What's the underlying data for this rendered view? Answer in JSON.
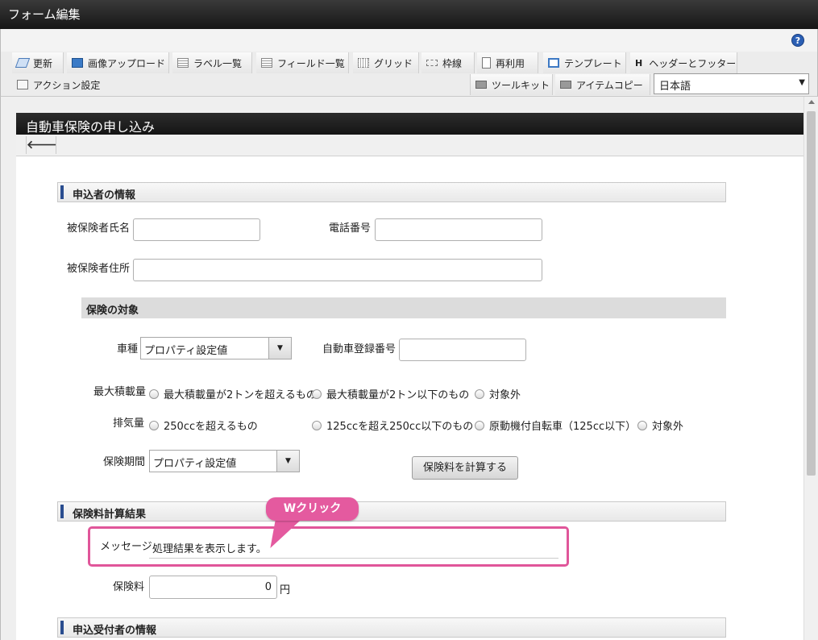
{
  "window": {
    "title": "フォーム編集",
    "help_symbol": "?"
  },
  "toolbar": {
    "row1": [
      {
        "name": "update-button",
        "icon": "update-icon",
        "label": "更新"
      },
      {
        "name": "image-upload-button",
        "icon": "image-icon",
        "label": "画像アップロード"
      },
      {
        "name": "label-list-button",
        "icon": "list-icon",
        "label": "ラベル一覧"
      },
      {
        "name": "field-list-button",
        "icon": "list-icon",
        "label": "フィールド一覧"
      },
      {
        "name": "grid-button",
        "icon": "grid-icon",
        "label": "グリッド"
      },
      {
        "name": "frame-line-button",
        "icon": "frame-icon",
        "label": "枠線"
      },
      {
        "name": "reuse-button",
        "icon": "reuse-icon",
        "label": "再利用"
      },
      {
        "name": "template-button",
        "icon": "template-icon",
        "label": "テンプレート"
      },
      {
        "name": "header-footer-button",
        "icon": "h-icon",
        "label": "ヘッダーとフッター"
      }
    ],
    "row2": [
      {
        "name": "action-settings-button",
        "icon": "action-icon",
        "label": "アクション設定"
      },
      {
        "name": "toolkit-button",
        "icon": "toolkit-icon",
        "label": "ツールキット"
      },
      {
        "name": "item-copy-button",
        "icon": "toolkit-icon",
        "label": "アイテムコピー"
      }
    ],
    "language": {
      "value": "日本語",
      "arrow": "▼"
    },
    "header_icon_letter": "H"
  },
  "form": {
    "title": "自動車保険の申し込み",
    "back_arrow": "🡐",
    "sections": {
      "applicant": "申込者の情報",
      "coverage": "保険の対象",
      "result": "保険料計算結果",
      "receiver": "申込受付者の情報"
    },
    "labels": {
      "insured_name": "被保険者氏名",
      "phone": "電話番号",
      "address": "被保険者住所",
      "car_type": "車種",
      "registration_no": "自動車登録番号",
      "max_load": "最大積載量",
      "displacement": "排気量",
      "period": "保険期間",
      "message": "メッセージ",
      "fee": "保険料",
      "yen": "円"
    },
    "selects": {
      "car_type": "プロパティ設定値",
      "period": "プロパティ設定値",
      "arrow": "▼"
    },
    "radios": {
      "max_load": [
        "最大積載量が2トンを超えるもの",
        "最大積載量が2トン以下のもの",
        "対象外"
      ],
      "displacement": [
        "250ccを超えるもの",
        "125ccを超え250cc以下のもの",
        "原動機付自転車（125cc以下）",
        "対象外"
      ]
    },
    "calc_button": "保険料を計算する",
    "message_value": "処理結果を表示します。",
    "fee_value": "0"
  },
  "annotation": {
    "callout": "Wクリック",
    "color": "#e45a9f"
  }
}
